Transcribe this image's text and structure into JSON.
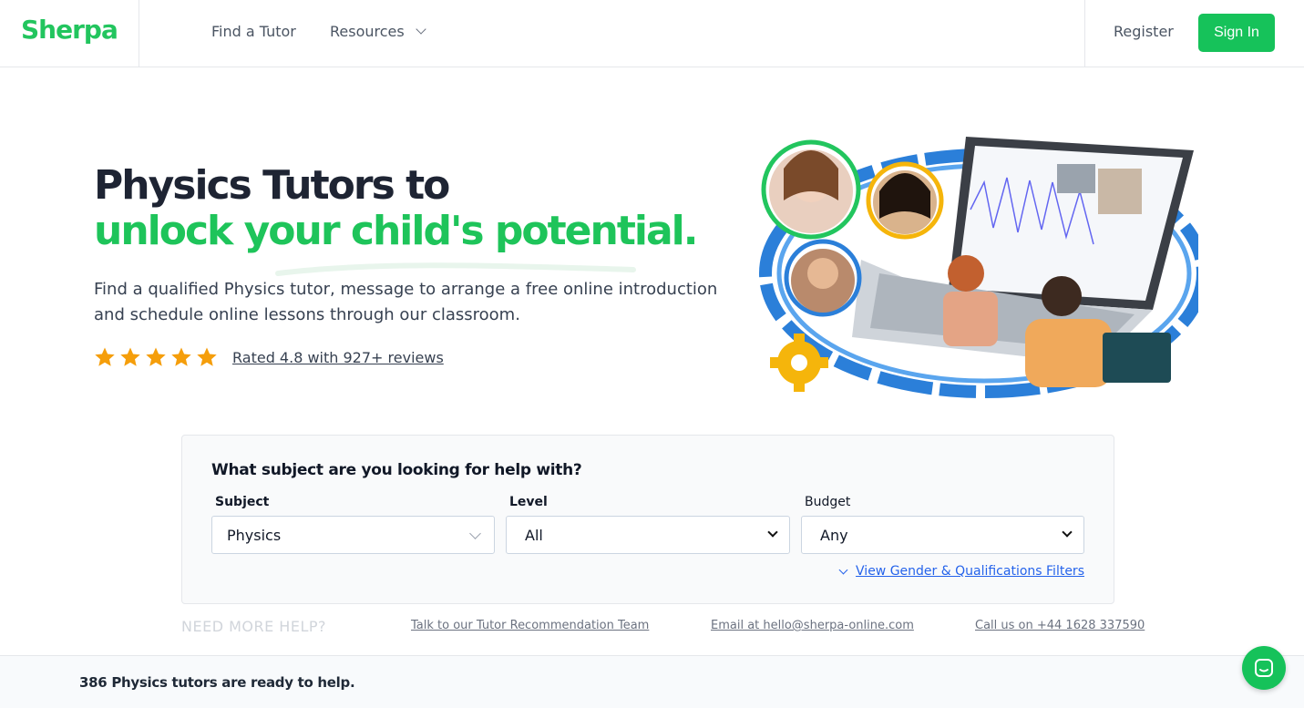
{
  "header": {
    "logo": "Sherpa",
    "nav": {
      "find_tutor": "Find a Tutor",
      "resources": "Resources"
    },
    "register": "Register",
    "sign_in": "Sign In"
  },
  "hero": {
    "title_line1": "Physics Tutors to",
    "title_line2": "unlock your child's potential.",
    "description": "Find a qualified Physics tutor, message to arrange a free online introduction and schedule online lessons through our classroom.",
    "rating_stars": 5,
    "rating_link": "Rated 4.8 with 927+ reviews"
  },
  "search": {
    "question": "What subject are you looking for help with?",
    "subject_label": "Subject",
    "subject_value": "Physics",
    "level_label": "Level",
    "level_value": "All",
    "budget_label": "Budget",
    "budget_value": "Any",
    "filters_link": "View Gender & Qualifications Filters"
  },
  "help": {
    "heading": "NEED MORE HELP?",
    "talk": "Talk to our Tutor Recommendation Team",
    "email": "Email at hello@sherpa-online.com",
    "call": "Call us on +44 1628 337590"
  },
  "bottom_bar": {
    "text": "386 Physics tutors are ready to help."
  },
  "colors": {
    "brand_green": "#16c25a",
    "headline_dark": "#1e2433",
    "link_blue": "#2563eb"
  },
  "icons": {
    "star": "star-icon",
    "chevron": "chevron-down-icon",
    "chat": "chat-icon"
  }
}
